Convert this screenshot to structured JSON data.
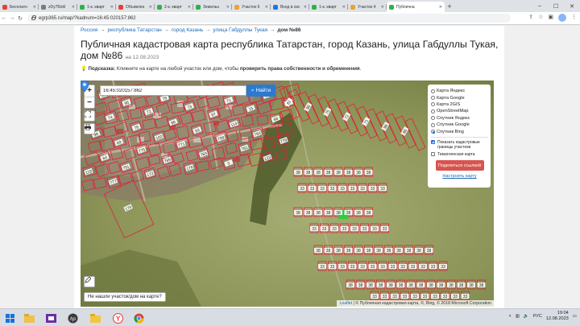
{
  "browser": {
    "tabs": [
      {
        "label": "Бесплатн",
        "color": "#e34234"
      },
      {
        "label": "zDy7RzkI",
        "color": "#7b7b7b"
      },
      {
        "label": "1-к. кварт",
        "color": "#30b14a"
      },
      {
        "label": "Объявлен",
        "color": "#e34234"
      },
      {
        "label": "2-к. кварт",
        "color": "#30b14a"
      },
      {
        "label": "Земельн",
        "color": "#30b14a"
      },
      {
        "label": "Участок 6",
        "color": "#e8a33d"
      },
      {
        "label": "Вход в сис",
        "color": "#1a73e8"
      },
      {
        "label": "1-к. кварт",
        "color": "#30b14a"
      },
      {
        "label": "Участок 4",
        "color": "#e8a33d"
      },
      {
        "label": "Публична",
        "color": "#30b14a",
        "active": true
      }
    ],
    "url": "egrp365.ru/map/?kadnum=16:45:020157:862"
  },
  "breadcrumbs": {
    "root": "Россия",
    "region": "республика Татарстан",
    "city": "город Казань",
    "street": "улица Габдуллы Тукая",
    "current": "дом №86",
    "sep": "→"
  },
  "page": {
    "title": "Публичная кадастровая карта республика Татарстан, город Казань, улица Габдуллы Тукая, дом №86",
    "date": "на 12.08.2023",
    "hint_label": "Подсказка:",
    "hint_text": "Кликните на карте на любой участок или дом, чтобы",
    "hint_bold": "проверить права собственности и обременения",
    "hint_end": "."
  },
  "map": {
    "search_value": "16:45:020157:862",
    "find_label": "Найти",
    "zoom_in": "+",
    "zoom_out": "−",
    "not_found": "Не нашли участок/дом на карте?",
    "layers": [
      {
        "label": "Карта Яндекс",
        "selected": false
      },
      {
        "label": "Карта Google",
        "selected": false
      },
      {
        "label": "Карта 2GIS",
        "selected": false
      },
      {
        "label": "OpenStreetMap",
        "selected": false
      },
      {
        "label": "Спутник Яндекс",
        "selected": false
      },
      {
        "label": "Спутник Google",
        "selected": false
      },
      {
        "label": "Спутник Bing",
        "selected": true
      }
    ],
    "show_borders_line1": "Показать кадастровые",
    "show_borders_line2": "границы участков",
    "show_borders_checked": true,
    "thematic_label": "Тематическая карта",
    "thematic_checked": false,
    "share_label": "Поделиться ссылкой",
    "setup_label": "Настроить карту",
    "attribution_leaflet": "Leaflet",
    "attribution_rest": "| © Публичная кадастровая карта, ©, Bing, © 2018 Microsoft Corporation",
    "plot_labels_top": [
      "81",
      "83",
      "96",
      "79",
      "75",
      "74",
      "72",
      "73",
      "71",
      "76",
      "98",
      "78",
      "86",
      "97",
      "15",
      "54",
      "69",
      "102",
      "93",
      "114",
      "88",
      "64",
      "775",
      "771",
      "799",
      "793",
      "119",
      "791",
      "789",
      "783",
      "781",
      "779",
      "777",
      "172",
      "176",
      "5",
      "123"
    ],
    "plot_label_grid": "38",
    "plot_label_grid2": "33",
    "plot_label_left": "176"
  },
  "taskbar": {
    "lang": "РУС",
    "time": "19:04",
    "date": "12.08.2023"
  },
  "colors": {
    "link": "#1b6bb8",
    "plot_border": "#e0203a",
    "selected_plot": "#2ecc40",
    "find_button": "#2c7ad0",
    "share_button": "#d9534f"
  }
}
